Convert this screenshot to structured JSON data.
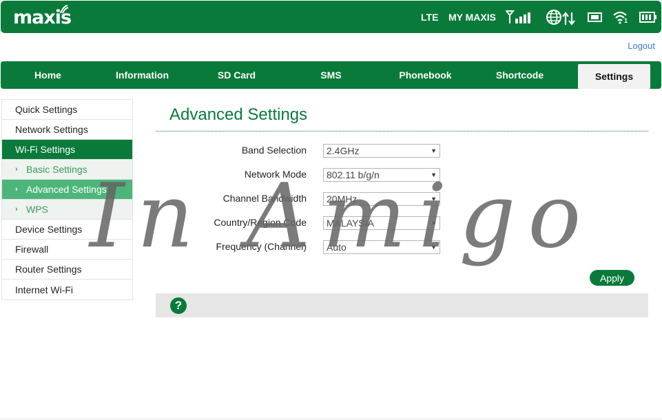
{
  "header": {
    "logo": "maxis",
    "network_type": "LTE",
    "operator": "MY MAXIS",
    "icons": [
      "signal-bars-icon",
      "globe-icon",
      "data-arrows-icon",
      "sim-card-icon",
      "wifi-icon",
      "battery-icon"
    ],
    "wifi_clients": "1"
  },
  "logout": "Logout",
  "nav": {
    "tabs": [
      {
        "label": "Home"
      },
      {
        "label": "Information"
      },
      {
        "label": "SD Card"
      },
      {
        "label": "SMS"
      },
      {
        "label": "Phonebook"
      },
      {
        "label": "Shortcode"
      },
      {
        "label": "Settings"
      }
    ],
    "active": "Settings"
  },
  "sidebar": {
    "items": [
      {
        "label": "Quick Settings"
      },
      {
        "label": "Network Settings"
      },
      {
        "label": "Wi-Fi Settings"
      },
      {
        "label": "Basic Settings"
      },
      {
        "label": "Advanced Settings"
      },
      {
        "label": "WPS"
      },
      {
        "label": "Device Settings"
      },
      {
        "label": "Firewall"
      },
      {
        "label": "Router Settings"
      },
      {
        "label": "Internet Wi-Fi"
      }
    ],
    "active_item": "Wi-Fi Settings",
    "active_sub": "Advanced Settings"
  },
  "main": {
    "title": "Advanced Settings",
    "fields": [
      {
        "label": "Band Selection",
        "value": "2.4GHz"
      },
      {
        "label": "Network Mode",
        "value": "802.11 b/g/n"
      },
      {
        "label": "Channel Bandwidth",
        "value": "20MHz"
      },
      {
        "label": "Country/Region Code",
        "value": "MALAYSIA"
      },
      {
        "label": "Frequency (Channel)",
        "value": "Auto"
      }
    ],
    "apply_label": "Apply",
    "help_label": "?"
  },
  "watermark": "In Amigo",
  "colors": {
    "brand_green": "#0a7a3a",
    "sub_active": "#4db57a",
    "link_blue": "#3a7bd5"
  }
}
